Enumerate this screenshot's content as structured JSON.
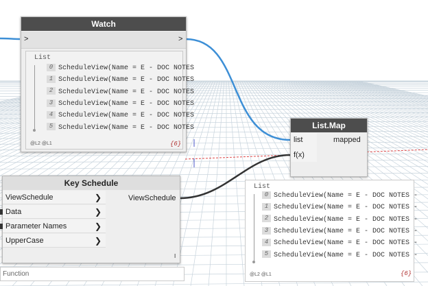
{
  "watch_node": {
    "title": "Watch",
    "input_port": ">",
    "output_port": ">",
    "list_label": "List",
    "items": [
      {
        "index": "0",
        "value": "ScheduleView(Name = E - DOC NOTES"
      },
      {
        "index": "1",
        "value": "ScheduleView(Name = E - DOC NOTES"
      },
      {
        "index": "2",
        "value": "ScheduleView(Name = E - DOC NOTES"
      },
      {
        "index": "3",
        "value": "ScheduleView(Name = E - DOC NOTES"
      },
      {
        "index": "4",
        "value": "ScheduleView(Name = E - DOC NOTES"
      },
      {
        "index": "5",
        "value": "ScheduleView(Name = E - DOC NOTES"
      }
    ],
    "levels": "@L2 @L1",
    "count": "{6}"
  },
  "listmap_node": {
    "title": "List.Map",
    "inputs": [
      "list",
      "f(x)"
    ],
    "output": "mapped",
    "preview": {
      "list_label": "List",
      "items": [
        {
          "index": "0",
          "value": "ScheduleView(Name = E - DOC NOTES -"
        },
        {
          "index": "1",
          "value": "ScheduleView(Name = E - DOC NOTES -"
        },
        {
          "index": "2",
          "value": "ScheduleView(Name = E - DOC NOTES -"
        },
        {
          "index": "3",
          "value": "ScheduleView(Name = E - DOC NOTES -"
        },
        {
          "index": "4",
          "value": "ScheduleView(Name = E - DOC NOTES -"
        },
        {
          "index": "5",
          "value": "ScheduleView(Name = E - DOC NOTES -"
        }
      ],
      "levels": "@L2 @L1",
      "count": "{6}"
    }
  },
  "keyschedule_node": {
    "title": "Key Schedule",
    "inputs": [
      "ViewSchedule",
      "Data",
      "Parameter Names",
      "UpperCase"
    ],
    "output": "ViewSchedule",
    "lacing": "I",
    "function_label": "Function"
  },
  "colors": {
    "node_header": "#4d4d4d",
    "node_body": "#eeeeee",
    "wire_blue": "#3d8fd6",
    "wire_dark": "#333333",
    "grid": "#c7d3dc"
  }
}
